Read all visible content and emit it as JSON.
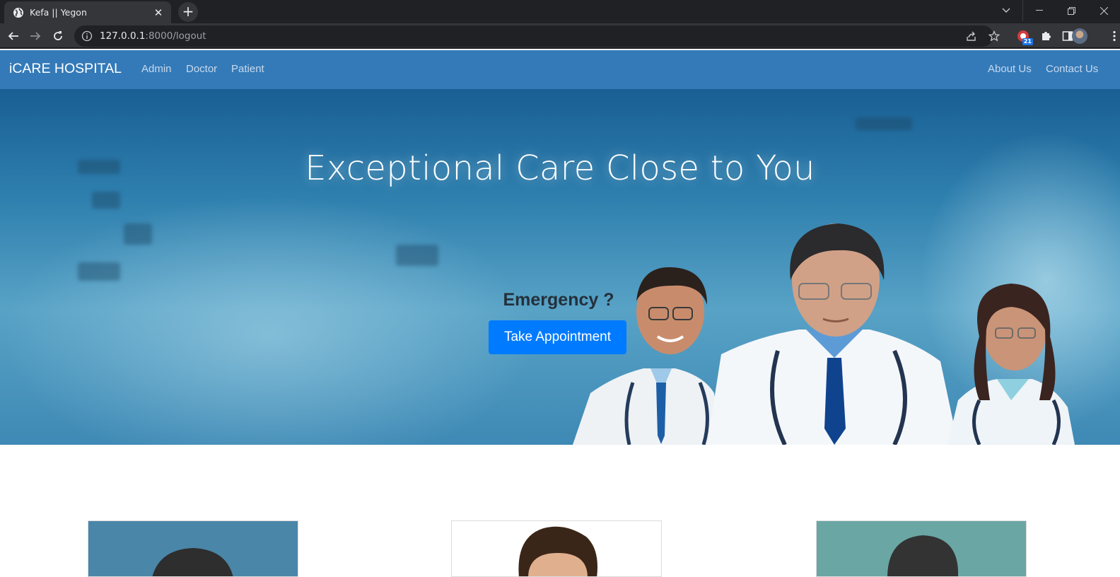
{
  "browser": {
    "tab_title": "Kefa || Yegon",
    "url_host": "127.0.0.1",
    "url_rest": ":8000/logout",
    "extension_badge": "21",
    "icons": [
      "globe-icon",
      "close-icon",
      "plus-icon",
      "back-icon",
      "forward-icon",
      "reload-icon",
      "info-icon",
      "share-icon",
      "star-icon",
      "extension-icon",
      "puzzle-icon",
      "sidebar-icon",
      "avatar",
      "menu-icon"
    ]
  },
  "navbar": {
    "brand": "iCARE HOSPITAL",
    "left_links": [
      "Admin",
      "Doctor",
      "Patient"
    ],
    "right_links": [
      "About Us",
      "Contact Us"
    ],
    "color": "#347ab8"
  },
  "hero": {
    "title": "Exceptional Care Close to You",
    "emergency": "Emergency ?",
    "cta": "Take Appointment",
    "cta_color": "#007bff"
  }
}
